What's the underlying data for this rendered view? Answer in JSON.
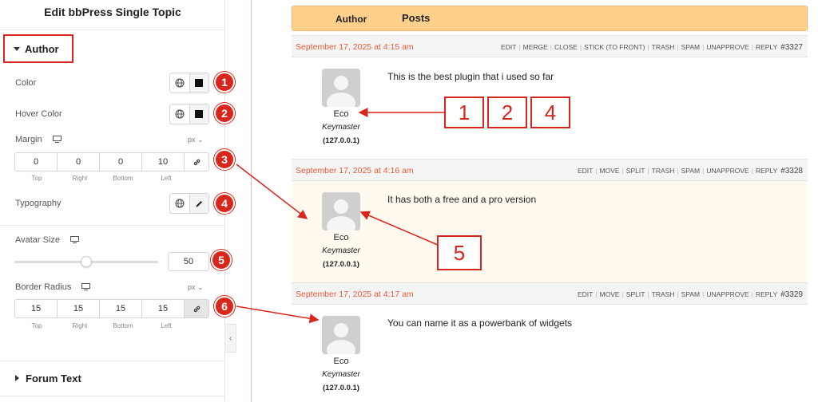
{
  "panel": {
    "title": "Edit bbPress Single Topic",
    "section_author": "Author",
    "color_label": "Color",
    "hover_color_label": "Hover Color",
    "margin_label": "Margin",
    "margin_unit": "px",
    "margin": {
      "top": "0",
      "right": "0",
      "bottom": "0",
      "left": "10"
    },
    "dim_labels": {
      "top": "Top",
      "right": "Right",
      "bottom": "Bottom",
      "left": "Left"
    },
    "typography_label": "Typography",
    "avatar_size_label": "Avatar Size",
    "avatar_size_value": "50",
    "border_radius_label": "Border Radius",
    "border_radius_unit": "px",
    "border_radius": {
      "top": "15",
      "right": "15",
      "bottom": "15",
      "left": "15"
    },
    "section_forum_text": "Forum Text"
  },
  "badges": [
    "1",
    "2",
    "3",
    "4",
    "5",
    "6"
  ],
  "topic": {
    "col_author": "Author",
    "col_posts": "Posts",
    "replies": [
      {
        "date": "September 17, 2025 at 4:15 am",
        "actions": [
          "EDIT",
          "MERGE",
          "CLOSE",
          "STICK (TO FRONT)",
          "TRASH",
          "SPAM",
          "UNAPPROVE",
          "REPLY"
        ],
        "id": "#3327",
        "author": "Eco",
        "role": "Keymaster",
        "ip": "(127.0.0.1)",
        "text": "This is the best plugin that i used so far"
      },
      {
        "date": "September 17, 2025 at 4:16 am",
        "actions": [
          "EDIT",
          "MOVE",
          "SPLIT",
          "TRASH",
          "SPAM",
          "UNAPPROVE",
          "REPLY"
        ],
        "id": "#3328",
        "author": "Eco",
        "role": "Keymaster",
        "ip": "(127.0.0.1)",
        "text": "It has both a free and a pro version"
      },
      {
        "date": "September 17, 2025 at 4:17 am",
        "actions": [
          "EDIT",
          "MOVE",
          "SPLIT",
          "TRASH",
          "SPAM",
          "UNAPPROVE",
          "REPLY"
        ],
        "id": "#3329",
        "author": "Eco",
        "role": "Keymaster",
        "ip": "(127.0.0.1)",
        "text": "You can name it as a powerbank of widgets"
      }
    ]
  },
  "callouts": {
    "c1": "1",
    "c2": "2",
    "c4": "4",
    "c5": "5"
  },
  "colors": {
    "accent_red": "#d9261c",
    "header_orange": "#ffcf8c",
    "date_orange": "#e45c3a"
  }
}
